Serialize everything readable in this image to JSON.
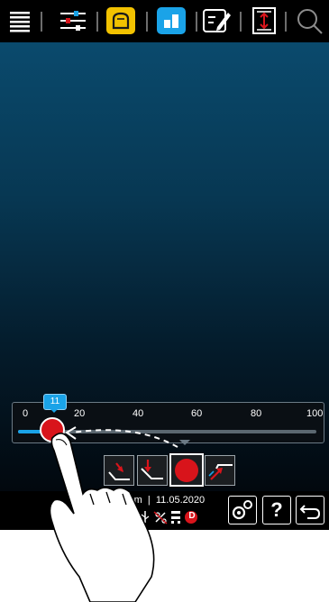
{
  "toolbar": {
    "icons": [
      "menu-icon",
      "filter-sliders-icon",
      "bread-icon",
      "layout-tile-icon",
      "edit-checklist-icon",
      "resize-vertical-icon",
      "search-icon"
    ],
    "active_color": "#f2c200",
    "highlight_color": "#1aa3e8"
  },
  "slider": {
    "ticks": [
      "0",
      "20",
      "40",
      "60",
      "80",
      "100"
    ],
    "value": 11,
    "value_label": "11",
    "track_color": "#1aa3e8",
    "knob_color": "#d8141b"
  },
  "modes": [
    "mode-fall-icon",
    "mode-drop-icon",
    "mode-record-icon",
    "mode-rise-icon"
  ],
  "status": {
    "time": "2:13 pm",
    "date": "11.05.2020",
    "icons": [
      "usb-icon",
      "no-signal-icon",
      "network-icon",
      "d-badge-icon"
    ],
    "d_label": "D"
  },
  "footer_buttons": {
    "settings": "settings-gears-icon",
    "help_label": "?",
    "back": "back-arrow-icon"
  }
}
